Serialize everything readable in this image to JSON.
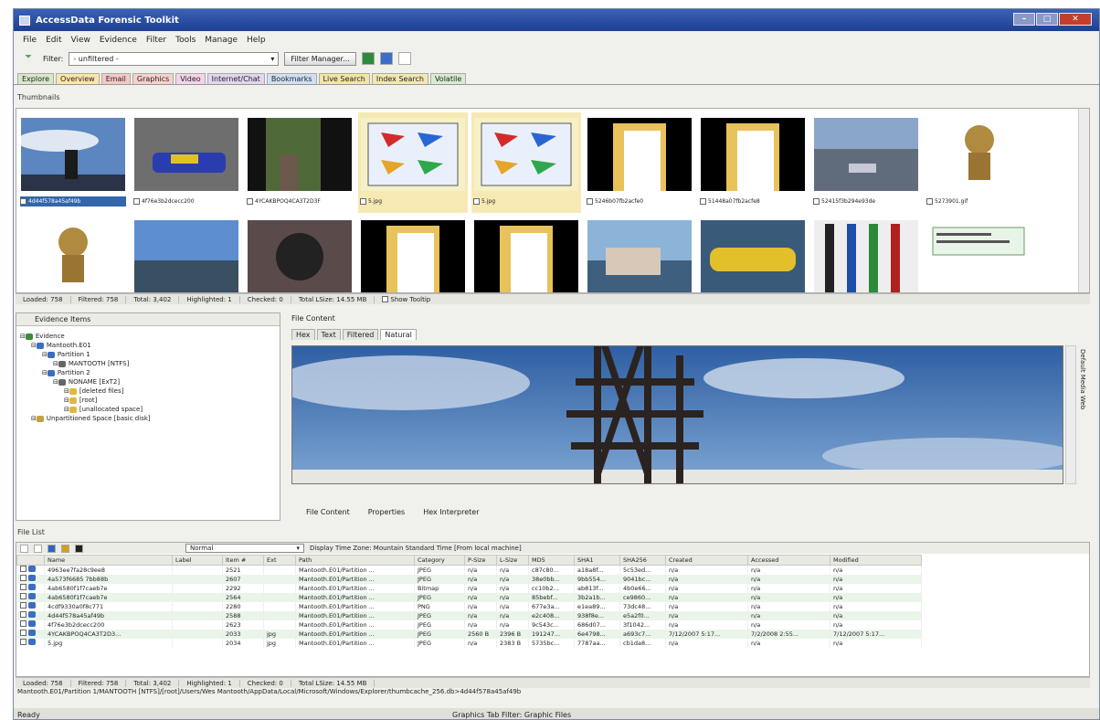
{
  "window": {
    "title": "AccessData Forensic Toolkit"
  },
  "menu": [
    "File",
    "Edit",
    "View",
    "Evidence",
    "Filter",
    "Tools",
    "Manage",
    "Help"
  ],
  "toolbar": {
    "filter_label": "Filter:",
    "filter_value": "- unfiltered -",
    "filter_manager": "Filter Manager..."
  },
  "tabs": [
    {
      "label": "Explore",
      "color": "#d8e8c8"
    },
    {
      "label": "Overview",
      "color": "#fde6a8"
    },
    {
      "label": "Email",
      "color": "#f6c9c4"
    },
    {
      "label": "Graphics",
      "color": "#f8d0cc"
    },
    {
      "label": "Video",
      "color": "#f4d4e8"
    },
    {
      "label": "Internet/Chat",
      "color": "#e0d6f0"
    },
    {
      "label": "Bookmarks",
      "color": "#cfe0f4"
    },
    {
      "label": "Live Search",
      "color": "#f4e6a0"
    },
    {
      "label": "Index Search",
      "color": "#f2e8b0"
    },
    {
      "label": "Volatile",
      "color": "#d8ecd0"
    }
  ],
  "thumbnails": {
    "title": "Thumbnails",
    "items": [
      {
        "name": "4d44f578a45af49b",
        "kind": "tower",
        "selected": true
      },
      {
        "name": "4f76e3b2dcecc200",
        "kind": "car"
      },
      {
        "name": "4YCAKBPOQ4CA3T2D3F",
        "kind": "dark"
      },
      {
        "name": "5.jpg",
        "kind": "flags",
        "hl": true
      },
      {
        "name": "5.jpg",
        "kind": "flags",
        "hl": true
      },
      {
        "name": "5246b07fb2acfe0",
        "kind": "folder"
      },
      {
        "name": "51448a07fb2acfe8",
        "kind": "folder"
      },
      {
        "name": "52415f3b294e93de",
        "kind": "lake"
      },
      {
        "name": "5273901.gif",
        "kind": "monkey"
      },
      {
        "name": "",
        "kind": "monkey"
      },
      {
        "name": "",
        "kind": "lake2"
      },
      {
        "name": "",
        "kind": "cat"
      },
      {
        "name": "",
        "kind": "folder"
      },
      {
        "name": "",
        "kind": "folder"
      },
      {
        "name": "",
        "kind": "boat"
      },
      {
        "name": "",
        "kind": "raft"
      },
      {
        "name": "",
        "kind": "pens"
      },
      {
        "name": "",
        "kind": "doc"
      }
    ]
  },
  "thumb_status": {
    "loaded": "Loaded: 758",
    "filtered": "Filtered: 758",
    "total": "Total: 3,402",
    "highlighted": "Highlighted: 1",
    "checked": "Checked: 0",
    "total_lsize": "Total LSize: 14.55 MB",
    "show_tooltip": "Show Tooltip"
  },
  "evidence": {
    "title": "Evidence Items",
    "tree": [
      {
        "label": "Evidence",
        "depth": 0
      },
      {
        "label": "Mantooth.E01",
        "depth": 1
      },
      {
        "label": "Partition 1",
        "depth": 2
      },
      {
        "label": "MANTOOTH [NTFS]",
        "depth": 3
      },
      {
        "label": "Partition 2",
        "depth": 2
      },
      {
        "label": "NONAME [ExT2]",
        "depth": 3
      },
      {
        "label": "[deleted files]",
        "depth": 4
      },
      {
        "label": "[root]",
        "depth": 4
      },
      {
        "label": "[unallocated space]",
        "depth": 4
      },
      {
        "label": "Unpartitioned Space [basic disk]",
        "depth": 1
      }
    ]
  },
  "file_content": {
    "title": "File Content",
    "tabs": [
      "Hex",
      "Text",
      "Filtered",
      "Natural"
    ],
    "bottom_tabs": [
      "File Content",
      "Properties",
      "Hex Interpreter"
    ],
    "side_label": "Default Media Web"
  },
  "file_list": {
    "title": "File List",
    "view_mode": "Normal",
    "timezone": "Display Time Zone: Mountain Standard Time  [From local machine]",
    "columns": [
      "Name",
      "Label",
      "Item #",
      "Ext",
      "Path",
      "Category",
      "P-Size",
      "L-Size",
      "MD5",
      "SHA1",
      "SHA256",
      "Created",
      "Accessed",
      "Modified"
    ],
    "rows": [
      [
        "4963ee7fa28c9ee8",
        "",
        "2521",
        "",
        "Mantooth.E01/Partition ...",
        "JPEG",
        "n/a",
        "n/a",
        "c87c80...",
        "a18a8f...",
        "5c53ed...",
        "n/a",
        "n/a",
        "n/a"
      ],
      [
        "4a573f6685 7bb88b",
        "",
        "2607",
        "",
        "Mantooth.E01/Partition ...",
        "JPEG",
        "n/a",
        "n/a",
        "38e0bb...",
        "9bb554...",
        "9041bc...",
        "n/a",
        "n/a",
        "n/a"
      ],
      [
        "4ab6580f1f7caeb7e",
        "",
        "2292",
        "",
        "Mantooth.E01/Partition ...",
        "Bitmap",
        "n/a",
        "n/a",
        "cc10b2...",
        "ab813f...",
        "4b0e66...",
        "n/a",
        "n/a",
        "n/a"
      ],
      [
        "4ab6580f1f7caeb7e",
        "",
        "2564",
        "",
        "Mantooth.E01/Partition ...",
        "JPEG",
        "n/a",
        "n/a",
        "85bebf...",
        "3b2a1b...",
        "ce9860...",
        "n/a",
        "n/a",
        "n/a"
      ],
      [
        "4cdf9330a0f8c771",
        "",
        "2280",
        "",
        "Mantooth.E01/Partition ...",
        "PNG",
        "n/a",
        "n/a",
        "677e3a...",
        "e1ea89...",
        "73dc48...",
        "n/a",
        "n/a",
        "n/a"
      ],
      [
        "4d44f578a45af49b",
        "",
        "2588",
        "",
        "Mantooth.E01/Partition ...",
        "JPEG",
        "n/a",
        "n/a",
        "e2c408...",
        "938f8e...",
        "e5a2f0...",
        "n/a",
        "n/a",
        "n/a"
      ],
      [
        "4f76e3b2dcecc200",
        "",
        "2623",
        "",
        "Mantooth.E01/Partition ...",
        "JPEG",
        "n/a",
        "n/a",
        "9c543c...",
        "686d07...",
        "3f1042...",
        "n/a",
        "n/a",
        "n/a"
      ],
      [
        "4YCAKBPOQ4CA3T2D3...",
        "",
        "2033",
        "jpg",
        "Mantooth.E01/Partition ...",
        "JPEG",
        "2560 B",
        "2396 B",
        "191247...",
        "6e4798...",
        "a693c7...",
        "7/12/2007 5:17...",
        "7/2/2008 2:55...",
        "7/12/2007 5:17..."
      ],
      [
        "5.jpg",
        "",
        "2034",
        "jpg",
        "Mantooth.E01/Partition ...",
        "JPEG",
        "n/a",
        "2383 B",
        "5735bc...",
        "7787aa...",
        "cb1da8...",
        "n/a",
        "n/a",
        "n/a"
      ]
    ]
  },
  "list_status": {
    "loaded": "Loaded: 758",
    "filtered": "Filtered: 758",
    "total": "Total: 3,402",
    "highlighted": "Highlighted: 1",
    "checked": "Checked: 0",
    "total_lsize": "Total LSize: 14.55 MB"
  },
  "path": "Mantooth.E01/Partition 1/MANTOOTH [NTFS]/[root]/Users/Wes Mantooth/AppData/Local/Microsoft/Windows/Explorer/thumbcache_256.db>4d44f578a45af49b",
  "ready": "Ready",
  "graphics_filter": "Graphics Tab Filter: Graphic Files"
}
